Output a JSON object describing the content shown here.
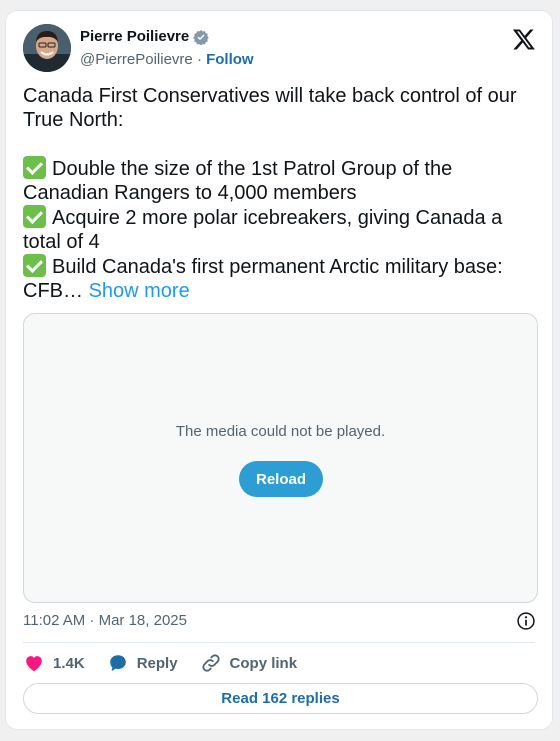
{
  "author": {
    "name": "Pierre Poilievre",
    "handle": "@PierrePoilievre",
    "separator": "·",
    "follow_label": "Follow",
    "verified_icon": "verified-badge-icon",
    "avatar_icon": "avatar"
  },
  "brand": {
    "logo_icon": "x-logo-icon"
  },
  "tweet": {
    "intro": "Canada First Conservatives will take back control of our True North:",
    "bullets": [
      "Double the size of the 1st Patrol Group of the Canadian Rangers to 4,000 members",
      "Acquire 2 more polar icebreakers, giving Canada a total of 4",
      "Build Canada's first permanent Arctic military base: CFB…"
    ],
    "bullet_icon": "check-mark-icon",
    "show_more_label": "Show more"
  },
  "media": {
    "message": "The media could not be played.",
    "reload_label": "Reload"
  },
  "timestamp": "11:02 AM · Mar 18, 2025",
  "info_icon": "info-icon",
  "actions": {
    "like_count": "1.4K",
    "reply_label": "Reply",
    "copy_link_label": "Copy link"
  },
  "read_replies_label": "Read 162 replies",
  "colors": {
    "link": "#1d6ea8",
    "show_more": "#1d9bf0",
    "reload_button": "#2c9ed4",
    "heart": "#f91880",
    "check": "#6cc04a"
  }
}
